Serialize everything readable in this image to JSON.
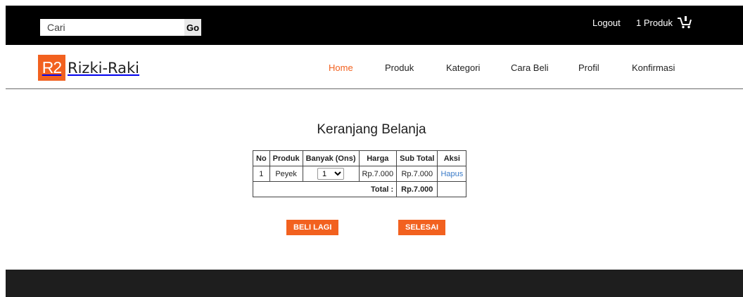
{
  "header": {
    "search_placeholder": "Cari",
    "search_button": "Go",
    "logout": "Logout",
    "cart_label": "1 Produk"
  },
  "brand": {
    "mark": "R2",
    "name": "Rizki-Raki"
  },
  "nav": [
    "Home",
    "Produk",
    "Kategori",
    "Cara Beli",
    "Profil",
    "Konfirmasi"
  ],
  "main": {
    "title": "Keranjang Belanja",
    "columns": [
      "No",
      "Produk",
      "Banyak (Ons)",
      "Harga",
      "Sub Total",
      "Aksi"
    ],
    "rows": [
      {
        "no": "1",
        "produk": "Peyek",
        "banyak": "1",
        "harga": "Rp.7.000",
        "subtotal": "Rp.7.000",
        "aksi": "Hapus"
      }
    ],
    "total_label": "Total :",
    "total_value": "Rp.7.000",
    "buy_again": "BELI LAGI",
    "finish": "SELESAI"
  },
  "colors": {
    "accent": "#f2611f",
    "topbar": "#000000",
    "footer": "#1e1e1e",
    "link": "#3a7bc8"
  }
}
